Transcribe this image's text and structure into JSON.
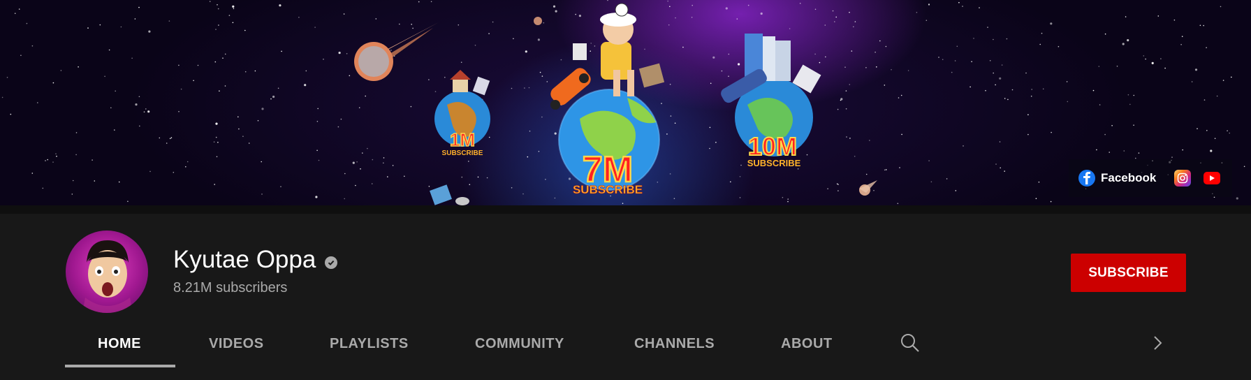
{
  "banner": {
    "links": [
      {
        "label": "Facebook",
        "icon": "facebook-icon"
      },
      {
        "label": "",
        "icon": "instagram-icon"
      },
      {
        "label": "",
        "icon": "youtube-icon"
      }
    ],
    "milestones": [
      "1M",
      "SUBSCRIBE",
      "7M",
      "SUBSCRIBE",
      "10M",
      "SUBSCRIBE"
    ]
  },
  "channel": {
    "name": "Kyutae Oppa",
    "subscribers": "8.21M subscribers",
    "verified_icon": "verified-check-icon",
    "subscribe_label": "SUBSCRIBE"
  },
  "tabs": [
    {
      "label": "HOME",
      "active": true
    },
    {
      "label": "VIDEOS",
      "active": false
    },
    {
      "label": "PLAYLISTS",
      "active": false
    },
    {
      "label": "COMMUNITY",
      "active": false
    },
    {
      "label": "CHANNELS",
      "active": false
    },
    {
      "label": "ABOUT",
      "active": false
    }
  ],
  "tab_icons": {
    "search": "search-icon",
    "next": "chevron-right-icon"
  },
  "colors": {
    "subscribe": "#cc0000",
    "background": "#181818",
    "facebook": "#1877f2",
    "youtube": "#ff0000"
  }
}
